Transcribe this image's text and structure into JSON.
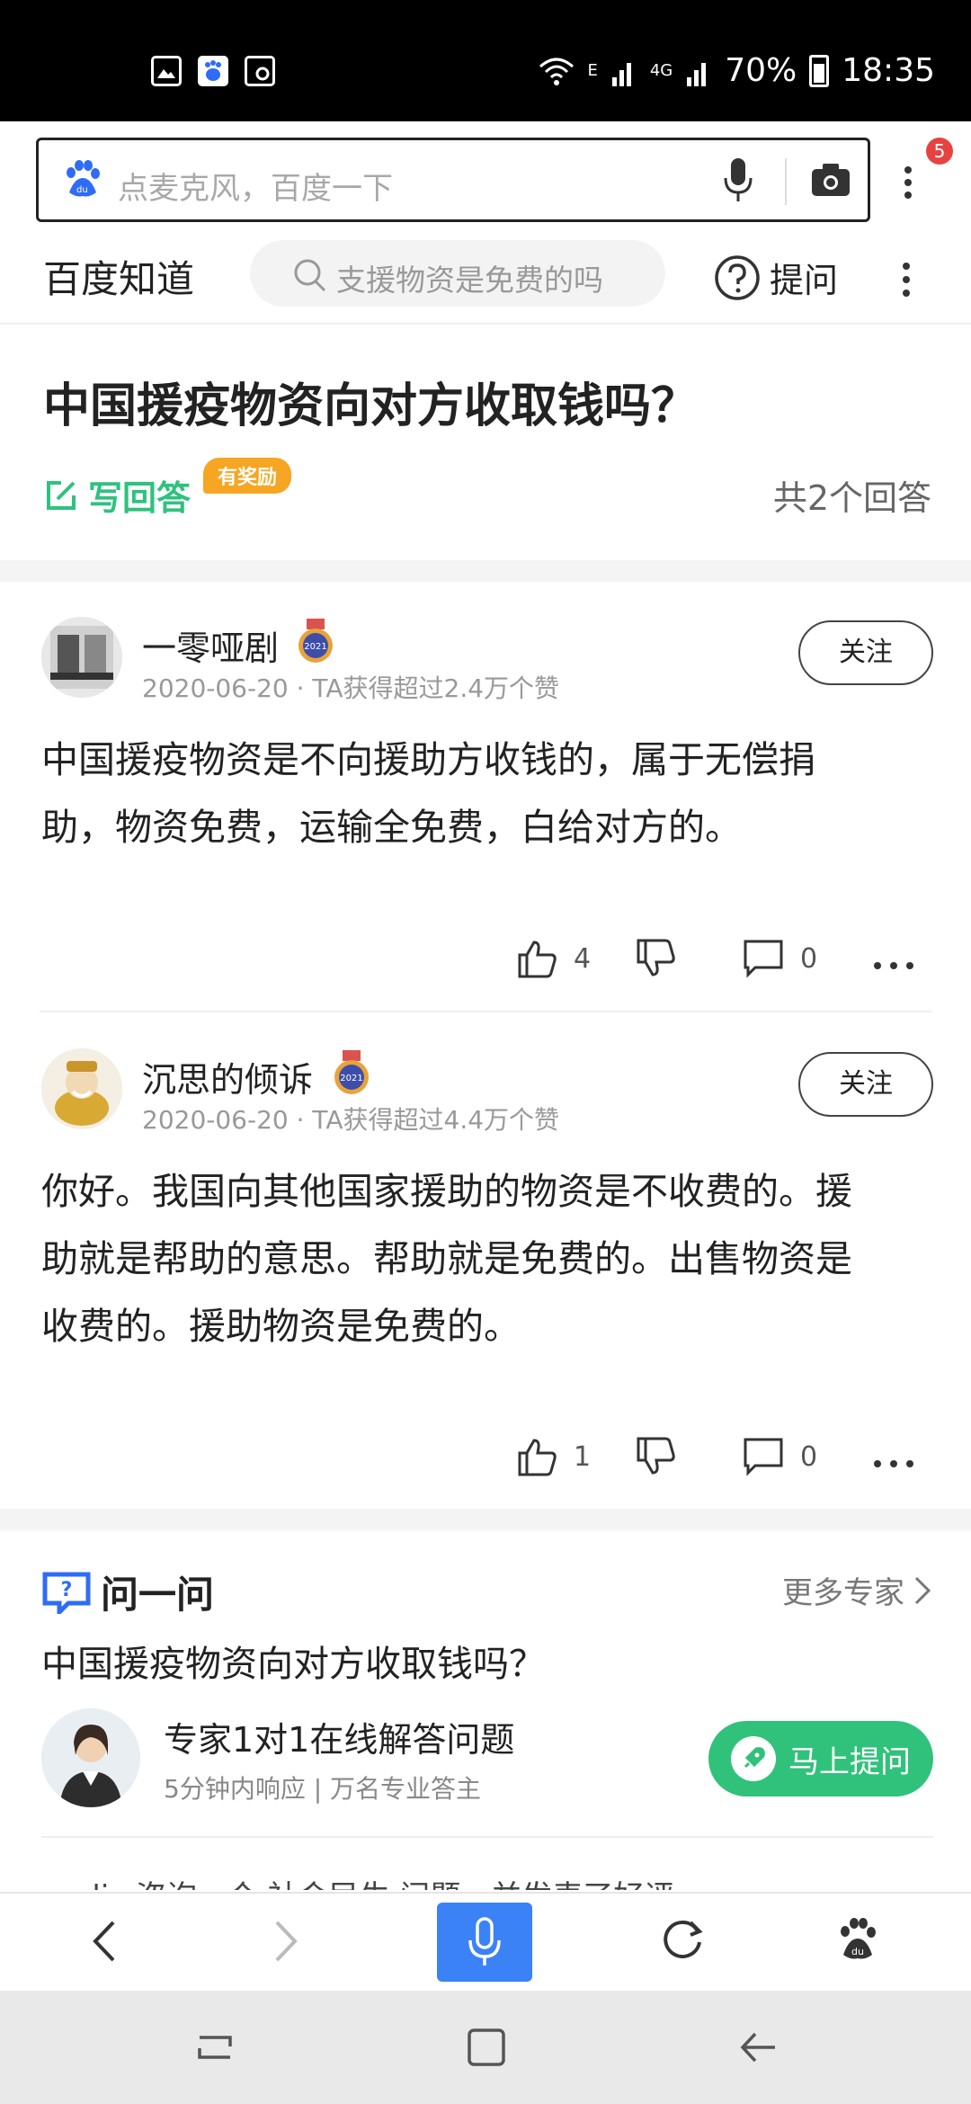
{
  "status_bar": {
    "battery": "70%",
    "time": "18:35",
    "network": "4G",
    "network_small": "E"
  },
  "browser": {
    "search_placeholder": "点麦克风，百度一下",
    "badge_count": "5"
  },
  "zhidao": {
    "logo": "百度知道",
    "search_placeholder": "支援物资是免费的吗",
    "ask_label": "提问"
  },
  "question": {
    "title": "中国援疫物资向对方收取钱吗？",
    "write_answer": "写回答",
    "reward_tag": "有奖励",
    "answer_count": "共2个回答"
  },
  "answers": [
    {
      "username": "一零哑剧",
      "medal": "2021",
      "meta": "2020-06-20 · TA获得超过2.4万个赞",
      "follow": "关注",
      "line1": "中国援疫物资是不向援助方收钱的，属于无偿捐",
      "line2": "助，物资免费，运输全免费，白给对方的。",
      "likes": "4",
      "comments": "0"
    },
    {
      "username": "沉思的倾诉",
      "medal": "2021",
      "meta": "2020-06-20 · TA获得超过4.4万个赞",
      "follow": "关注",
      "line1": "你好。我国向其他国家援助的物资是不收费的。援",
      "line2": "助就是帮助的意思。帮助就是免费的。出售物资是",
      "line3": "收费的。援助物资是免费的。",
      "likes": "1",
      "comments": "0"
    }
  ],
  "ask_section": {
    "title": "问一问",
    "more": "更多专家",
    "question": "中国援疫物资向对方收取钱吗？",
    "expert_title": "专家1对1在线解答问题",
    "expert_sub": "5分钟内响应 | 万名专业答主",
    "ask_button": "马上提问",
    "peek": "garlic 咨询一个 社会民生 问题，并发表了好评"
  },
  "colors": {
    "green": "#2ec27e",
    "blue": "#3b82f6",
    "badge_red": "#e64340",
    "reward_orange": "#f6a623"
  },
  "icons": [
    "gallery-icon",
    "baidu-icon",
    "screen-record-icon",
    "wifi-icon",
    "signal-icon",
    "battery-icon",
    "baidu-paw-icon",
    "microphone-icon",
    "camera-icon",
    "search-icon",
    "help-circle-icon",
    "edit-icon",
    "thumbs-up-icon",
    "thumbs-down-icon",
    "comment-icon",
    "chevron-right-icon",
    "rocket-icon",
    "back-icon",
    "forward-icon",
    "refresh-icon",
    "recent-apps-icon",
    "home-icon",
    "nav-back-icon"
  ]
}
